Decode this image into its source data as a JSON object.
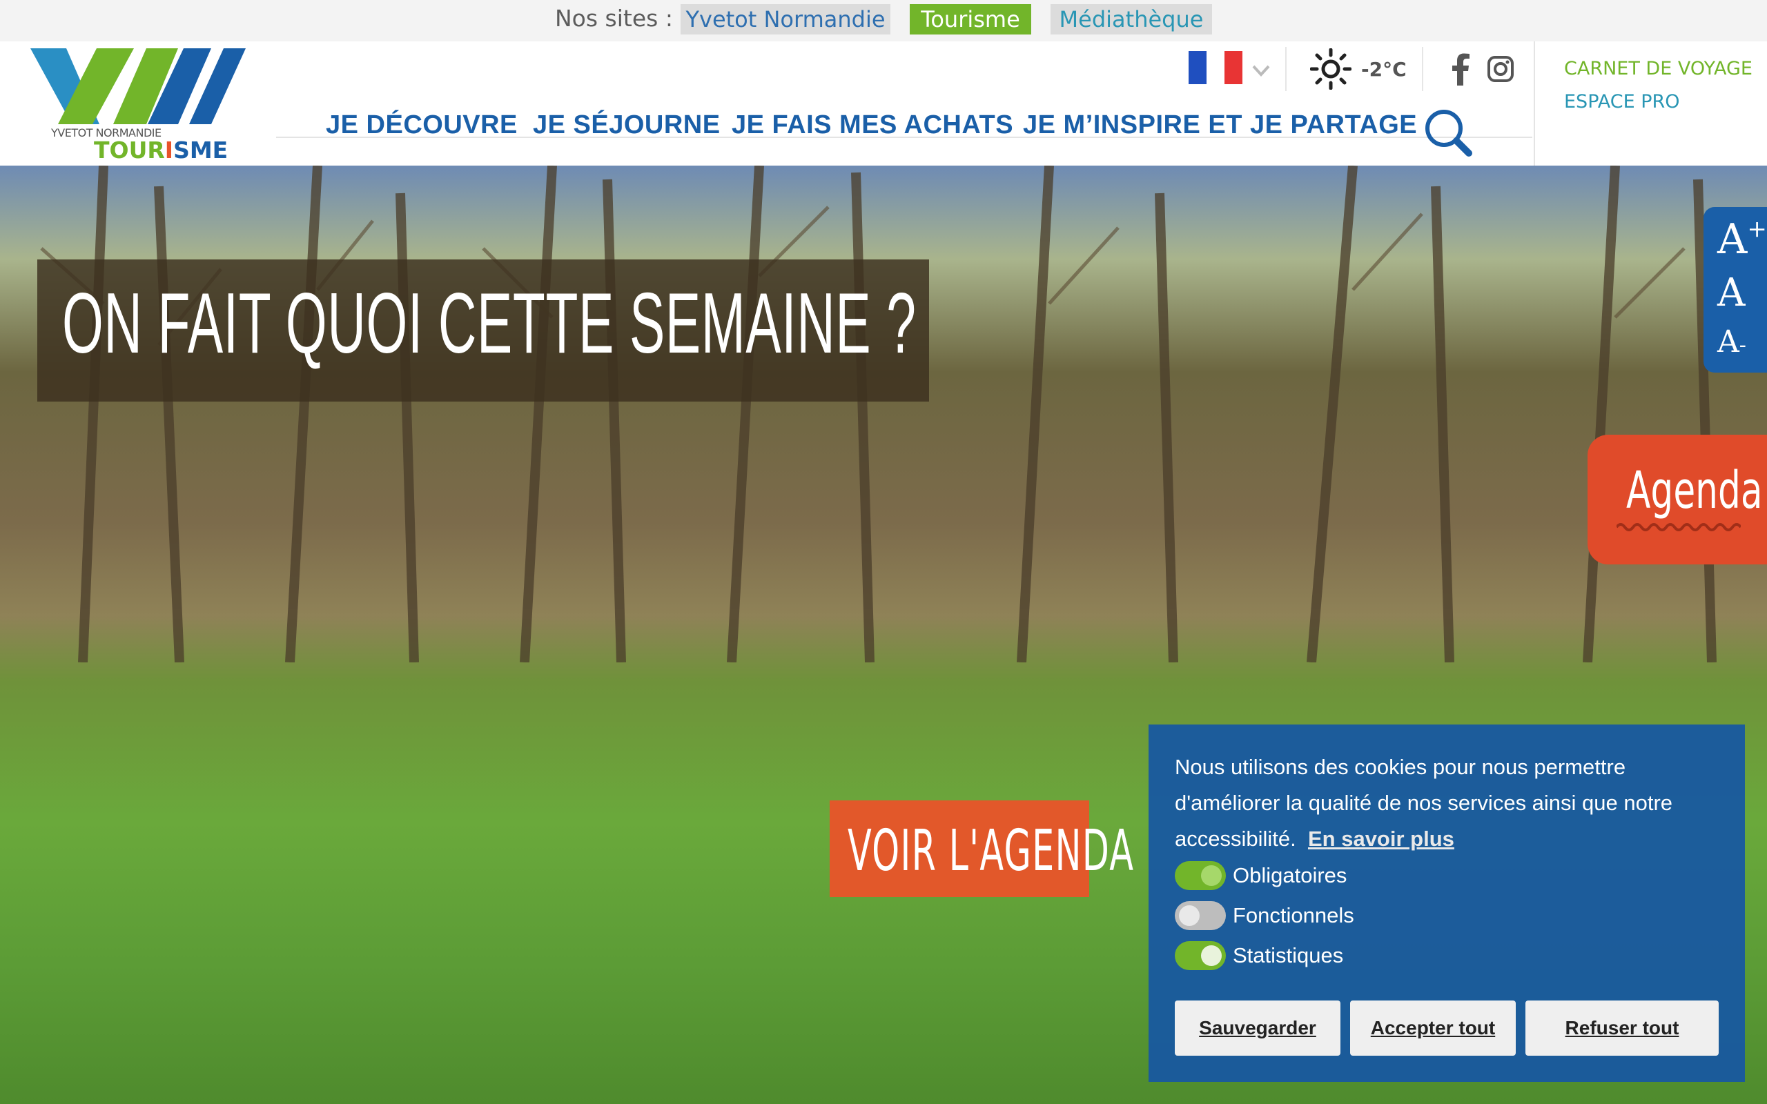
{
  "sites_bar": {
    "label": "Nos sites :",
    "sites": [
      "Yvetot Normandie",
      "Tourisme",
      "Médiathèque"
    ]
  },
  "logo": {
    "subtitle": "YVETOT NORMANDIE",
    "wordmark_parts": [
      "TOUR",
      "I",
      "SME"
    ]
  },
  "utility": {
    "language_flag": "flag-france-icon",
    "weather_icon": "sun-icon",
    "temperature": "-2°C",
    "social": [
      "facebook-icon",
      "instagram-icon"
    ]
  },
  "right_links": {
    "carnet": "CARNET DE VOYAGE",
    "pro": "ESPACE PRO"
  },
  "nav": {
    "items": [
      "JE DÉCOUVRE",
      "JE SÉJOURNE",
      "JE FAIS MES ACHATS",
      "JE M’INSPIRE ET JE PARTAGE"
    ]
  },
  "hero": {
    "headline": "ON FAIT QUOI CETTE SEMAINE ?",
    "cta": "VOIR L'AGENDA",
    "agenda_tab": "Agenda"
  },
  "accessibility": {
    "increase": "A",
    "normal": "A",
    "decrease": "A",
    "plus": "+",
    "minus": "-"
  },
  "cookie": {
    "text": "Nous utilisons des cookies pour nous permettre d'améliorer la qualité de nos services ainsi que notre accessibilité.",
    "more": "En savoir plus",
    "toggles": [
      {
        "label": "Obligatoires",
        "on": true
      },
      {
        "label": "Fonctionnels",
        "on": false
      },
      {
        "label": "Statistiques",
        "on": true
      }
    ],
    "buttons": [
      "Sauvegarder",
      "Accepter tout",
      "Refuser tout"
    ]
  },
  "colors": {
    "brand_blue": "#1a5fa8",
    "brand_green": "#72b52a",
    "accent_orange": "#e2582a",
    "teal": "#2996b4"
  }
}
